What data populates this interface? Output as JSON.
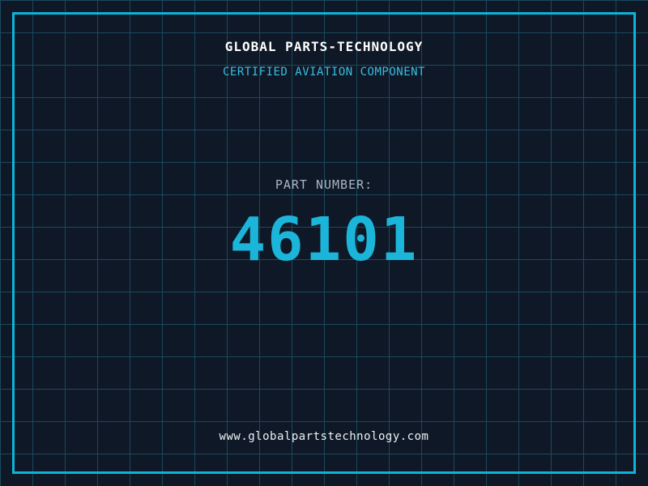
{
  "colors": {
    "bg": "#0f1826",
    "grid": "#1a495e",
    "frame": "#0db4da",
    "title": "#ffffff",
    "subtitle": "#38bde2",
    "label": "#a8b5c4",
    "number": "#1cb5da",
    "url": "#eef2f6"
  },
  "header": {
    "title": "GLOBAL PARTS-TECHNOLOGY",
    "subtitle": "CERTIFIED AVIATION COMPONENT"
  },
  "part": {
    "label": "PART NUMBER:",
    "number": "46101"
  },
  "footer": {
    "url": "www.globalpartstechnology.com"
  }
}
